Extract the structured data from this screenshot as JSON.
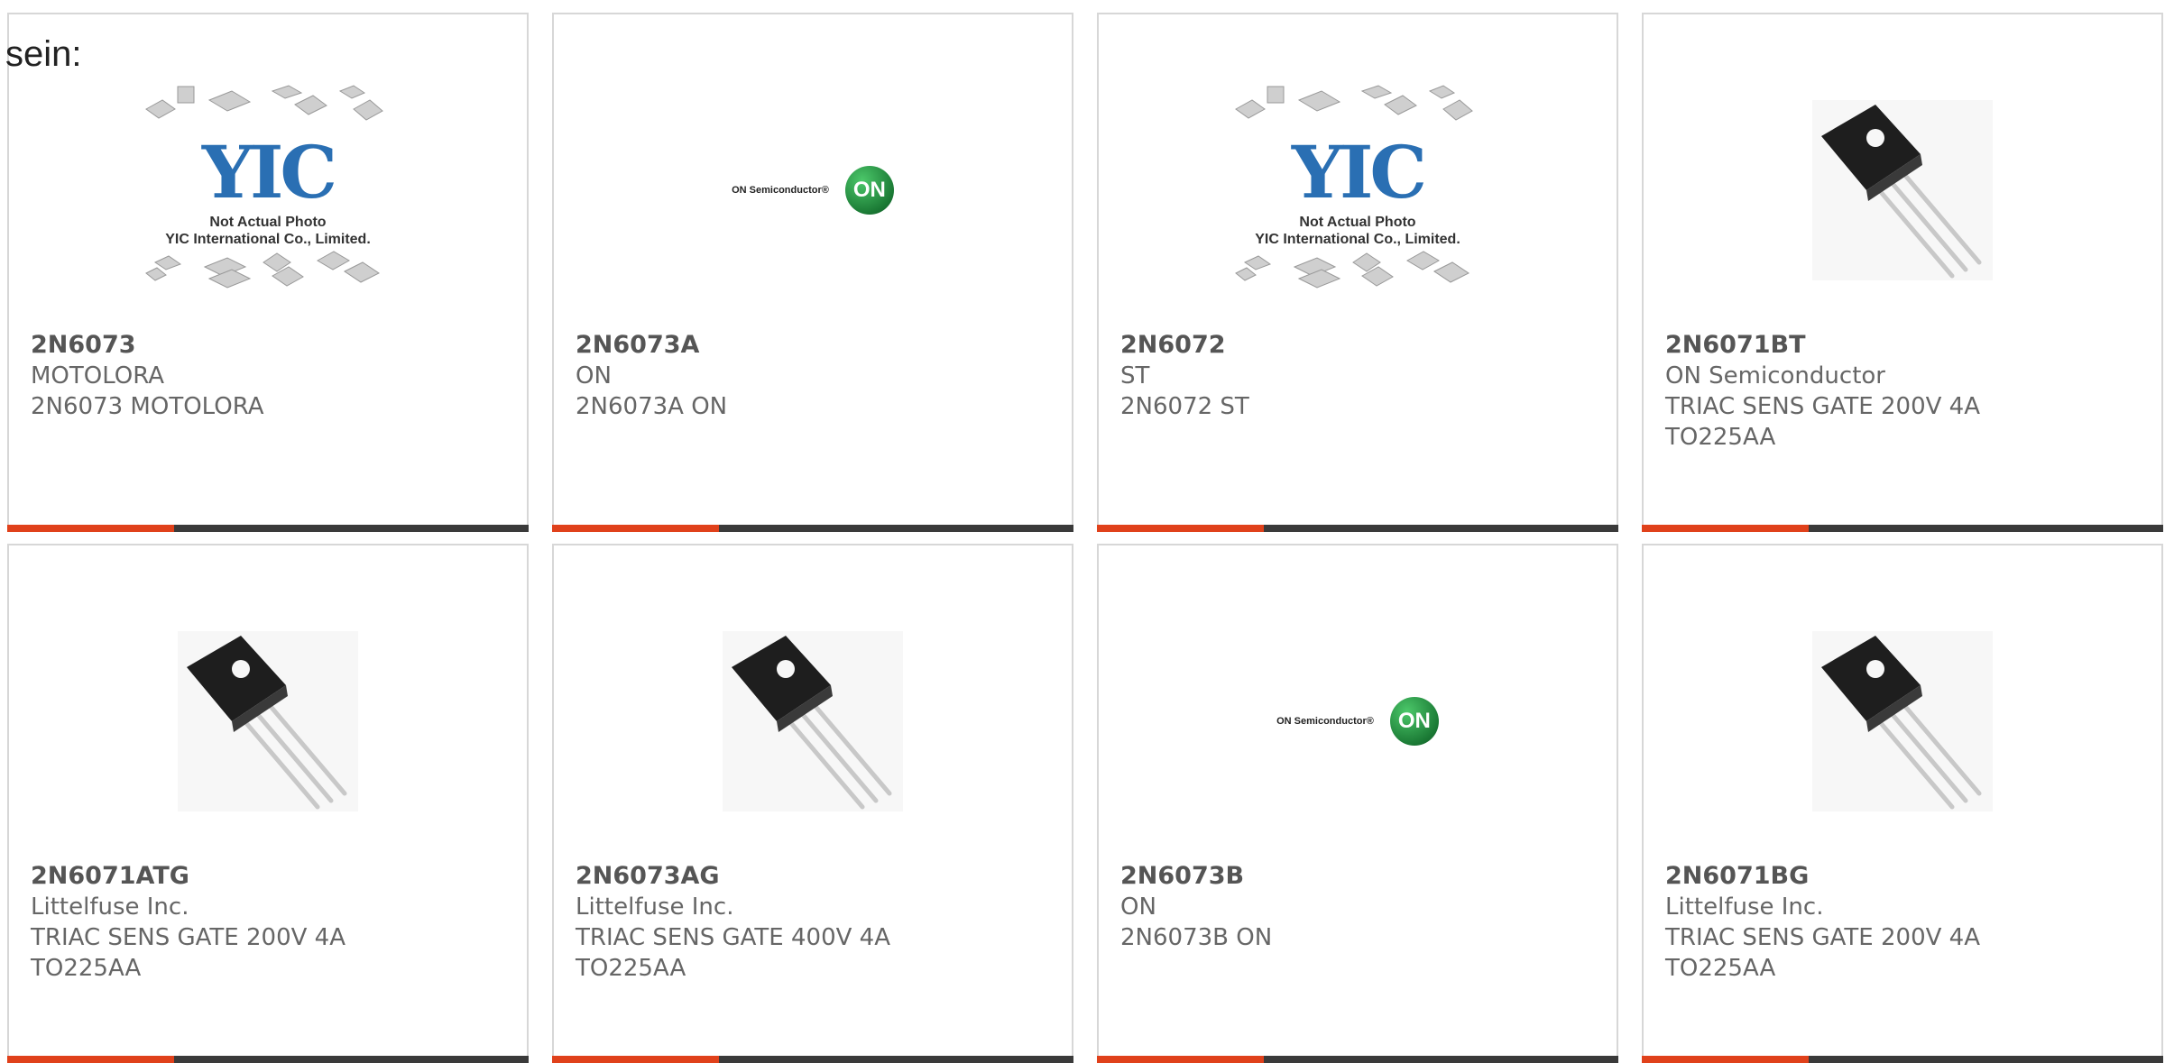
{
  "fragment_text": "sein:",
  "placeholder": {
    "logo": "YIC",
    "line1": "Not Actual Photo",
    "line2": "YIC International Co., Limited."
  },
  "on_logo": {
    "wordmark": "ON Semiconductor®",
    "badge": "ON"
  },
  "colors": {
    "accent_bar": "#e0411b",
    "base_bar": "#3a3a3a"
  },
  "products": [
    {
      "part": "2N6073",
      "maker": "MOTOLORA",
      "desc": "2N6073 MOTOLORA",
      "image": "yic-placeholder"
    },
    {
      "part": "2N6073A",
      "maker": "ON",
      "desc": "2N6073A ON",
      "image": "on-semiconductor-logo"
    },
    {
      "part": "2N6072",
      "maker": "ST",
      "desc": "2N6072 ST",
      "image": "yic-placeholder"
    },
    {
      "part": "2N6071BT",
      "maker": "ON Semiconductor",
      "desc": "TRIAC SENS GATE 200V 4A",
      "desc2": "TO225AA",
      "image": "to225-transistor"
    },
    {
      "part": "2N6071ATG",
      "maker": "Littelfuse Inc.",
      "desc": "TRIAC SENS GATE 200V 4A",
      "desc2": "TO225AA",
      "image": "to225-transistor"
    },
    {
      "part": "2N6073AG",
      "maker": "Littelfuse Inc.",
      "desc": "TRIAC SENS GATE 400V 4A",
      "desc2": "TO225AA",
      "image": "to225-transistor"
    },
    {
      "part": "2N6073B",
      "maker": "ON",
      "desc": "2N6073B ON",
      "image": "on-semiconductor-logo"
    },
    {
      "part": "2N6071BG",
      "maker": "Littelfuse Inc.",
      "desc": "TRIAC SENS GATE 200V 4A",
      "desc2": "TO225AA",
      "image": "to225-transistor"
    }
  ]
}
